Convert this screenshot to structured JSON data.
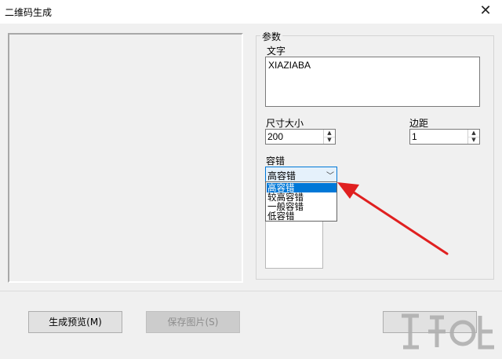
{
  "window": {
    "title": "二维码生成",
    "close_glyph": "✕"
  },
  "params": {
    "group_label": "参数",
    "text_label": "文字",
    "text_value": "XIAZIABA",
    "size_label": "尺寸大小",
    "size_value": "200",
    "margin_label": "边距",
    "margin_value": "1",
    "ecc_label": "容错",
    "ecc_selected": "高容错",
    "ecc_options": [
      "高容错",
      "较高容错",
      "一般容错",
      "低容错"
    ]
  },
  "buttons": {
    "preview": "生成预览(M)",
    "save": "保存图片(S)"
  },
  "annotation": {
    "arrow_color": "#e02020"
  },
  "colors": {
    "selection": "#0078d7"
  }
}
